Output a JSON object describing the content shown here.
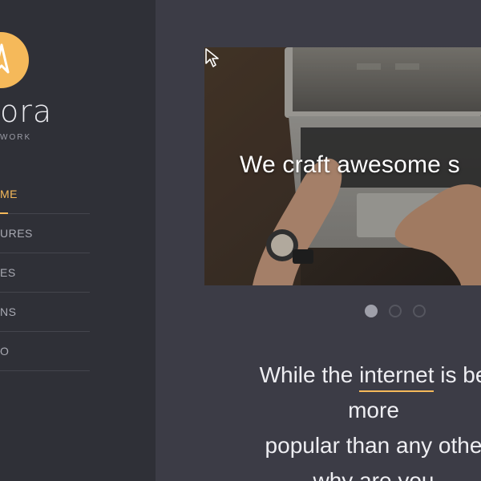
{
  "brand": {
    "name": "ora",
    "tagline": "WORK",
    "accent_color": "#f5b95a",
    "logo_icon": "compass-icon"
  },
  "sidebar": {
    "items": [
      {
        "label": "ME",
        "active": true
      },
      {
        "label": "URES",
        "active": false
      },
      {
        "label": "ES",
        "active": false
      },
      {
        "label": "NS",
        "active": false
      },
      {
        "label": "O",
        "active": false
      }
    ]
  },
  "hero": {
    "caption": "We craft awesome s",
    "slides_total": 3,
    "active_slide": 1
  },
  "intro": {
    "line1_before": "While the ",
    "line1_highlight": "internet",
    "line1_after": " is be",
    "line2": "more",
    "line3": "popular than any othe",
    "line4": "why are you"
  }
}
